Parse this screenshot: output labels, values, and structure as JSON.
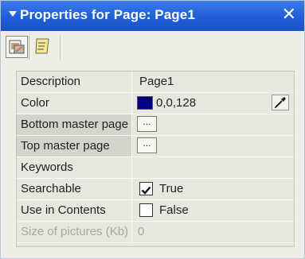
{
  "window": {
    "title": "Properties for Page: Page1",
    "collapse_icon": "triangle-down-icon",
    "close_icon": "close-x-icon",
    "accent_color": "#1f5ed6"
  },
  "toolbar": {
    "buttons": [
      {
        "icon": "page-properties-icon",
        "active": true
      },
      {
        "icon": "notes-icon",
        "active": false
      }
    ]
  },
  "properties": {
    "rows": [
      {
        "name": "Description",
        "value": "Page1"
      },
      {
        "name": "Color",
        "value": "0,0,128",
        "swatch_color": "#000080",
        "button_icon": "eyedropper-icon"
      },
      {
        "name": "Bottom master page",
        "button_label": "..."
      },
      {
        "name": "Top master page",
        "button_label": "..."
      },
      {
        "name": "Keywords",
        "value": ""
      },
      {
        "name": "Searchable",
        "checked": true,
        "value": "True"
      },
      {
        "name": "Use in Contents",
        "checked": false,
        "value": "False"
      },
      {
        "name": "Size of pictures (Kb)",
        "value": "0",
        "disabled": true
      }
    ]
  }
}
